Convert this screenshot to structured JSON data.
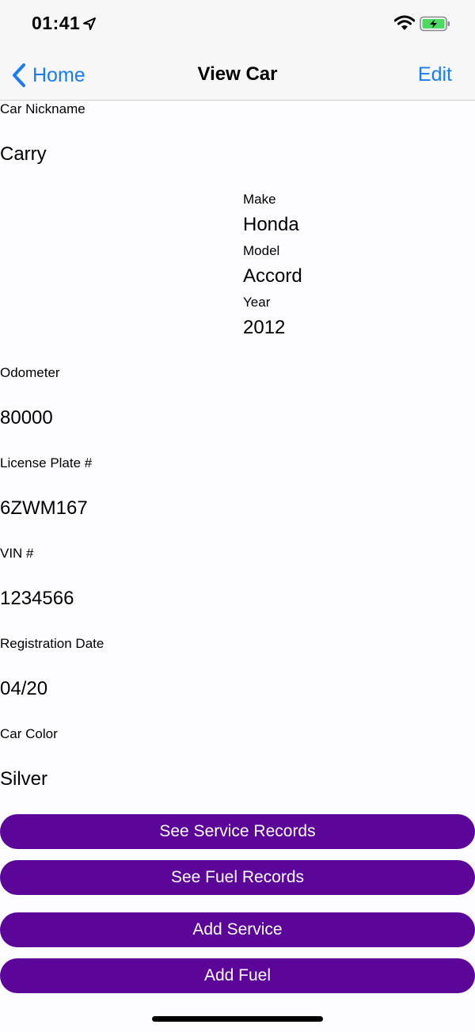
{
  "status_bar": {
    "time": "01:41"
  },
  "nav": {
    "back_label": "Home",
    "title": "View Car",
    "edit_label": "Edit"
  },
  "fields": {
    "nickname": {
      "label": "Car Nickname",
      "value": "Carry"
    },
    "make": {
      "label": "Make",
      "value": "Honda"
    },
    "model": {
      "label": "Model",
      "value": "Accord"
    },
    "year": {
      "label": "Year",
      "value": "2012"
    },
    "odometer": {
      "label": "Odometer",
      "value": "80000"
    },
    "license_plate": {
      "label": "License Plate #",
      "value": "6ZWM167"
    },
    "vin": {
      "label": "VIN #",
      "value": "1234566"
    },
    "registration_date": {
      "label": "Registration Date",
      "value": "04/20"
    },
    "car_color": {
      "label": "Car Color",
      "value": "Silver"
    }
  },
  "buttons": {
    "see_service": "See Service Records",
    "see_fuel": "See Fuel Records",
    "add_service": "Add Service",
    "add_fuel": "Add Fuel"
  },
  "colors": {
    "accent": "#1a7cf5",
    "button": "#5b0699",
    "battery": "#4cd964"
  }
}
